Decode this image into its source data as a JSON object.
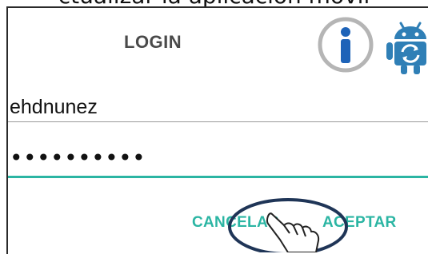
{
  "caption": "ctualizar la aplicación móvil",
  "dialog": {
    "title": "LOGIN",
    "username_value": "ehdnunez",
    "password_value": "••••••••••",
    "cancel_label": "CANCELAR",
    "accept_label": "ACEPTAR"
  },
  "icons": {
    "info": "info-icon",
    "update": "android-update-icon",
    "hand": "pointing-hand-icon"
  },
  "colors": {
    "accent": "#2bb5a3",
    "highlight_ring": "#1f3557",
    "title": "#4a4a4a",
    "info_blue": "#1e63b8",
    "android_blue": "#2f7fb6"
  }
}
